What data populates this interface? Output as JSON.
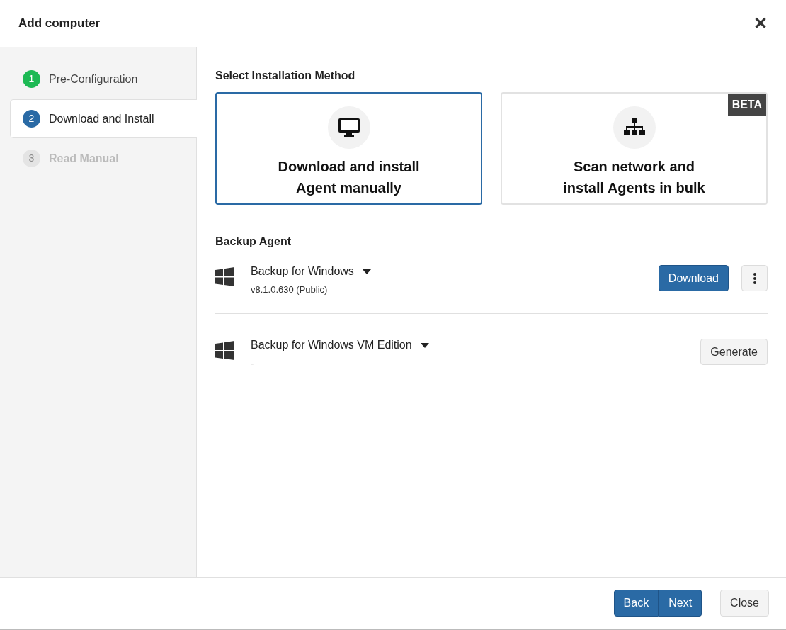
{
  "dialog": {
    "title": "Add computer",
    "close_icon": "✕"
  },
  "steps": [
    {
      "number": "1",
      "label": "Pre-Configuration",
      "kind": "done",
      "selected": false
    },
    {
      "number": "2",
      "label": "Download and Install",
      "kind": "current",
      "selected": true
    },
    {
      "number": "3",
      "label": "Read Manual",
      "kind": "pending",
      "selected": false
    }
  ],
  "method_section": {
    "heading": "Select Installation Method",
    "methods": [
      {
        "kind": "monitor",
        "label": "Download and install Agent manually",
        "selected": true
      },
      {
        "kind": "network",
        "label": "Scan network and install Agents in bulk",
        "selected": false,
        "badge": "BETA"
      }
    ]
  },
  "agent_section": {
    "heading": "Backup Agent",
    "agents": [
      {
        "name": "Backup for Windows",
        "version": "v8.1.0.630 (Public)",
        "action": {
          "label": "Download",
          "kind": "primary"
        },
        "has_menu": true
      },
      {
        "name": "Backup for Windows VM Edition",
        "version": "-",
        "action": {
          "label": "Generate",
          "kind": "default"
        },
        "has_menu": false
      }
    ]
  },
  "footer": {
    "buttons": [
      {
        "label": "Back",
        "kind": "primary"
      },
      {
        "label": "Next",
        "kind": "primary"
      },
      {
        "label": "Close",
        "kind": "default"
      }
    ]
  }
}
